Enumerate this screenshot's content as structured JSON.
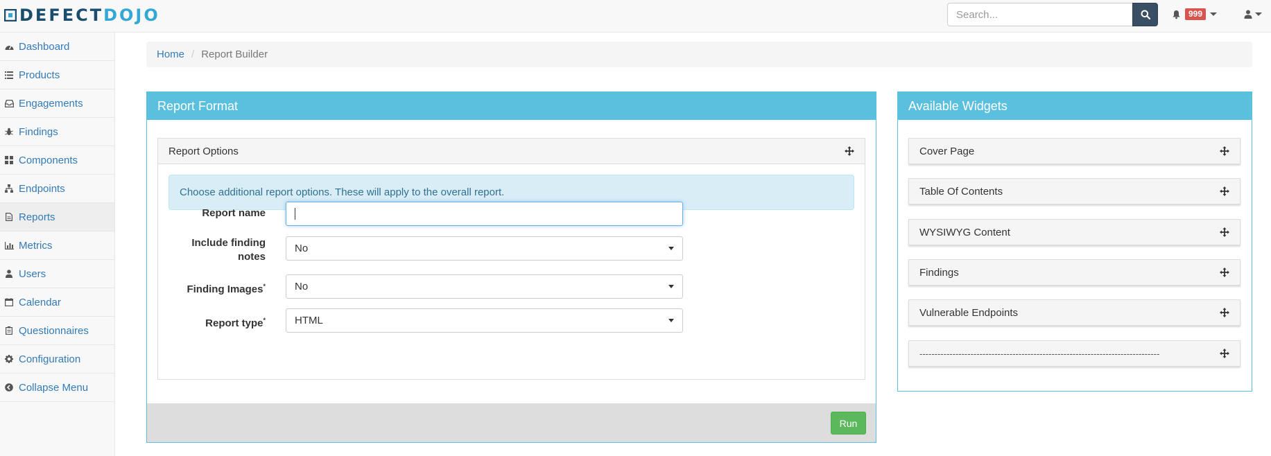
{
  "app": {
    "logo_part1": "DEFECT",
    "logo_part2": "DOJO"
  },
  "search": {
    "placeholder": "Search..."
  },
  "notifications": {
    "count": "999"
  },
  "sidebar": {
    "items": [
      {
        "label": "Dashboard",
        "icon": "dashboard-icon"
      },
      {
        "label": "Products",
        "icon": "list-icon"
      },
      {
        "label": "Engagements",
        "icon": "inbox-icon"
      },
      {
        "label": "Findings",
        "icon": "bug-icon"
      },
      {
        "label": "Components",
        "icon": "grid-icon"
      },
      {
        "label": "Endpoints",
        "icon": "sitemap-icon"
      },
      {
        "label": "Reports",
        "icon": "file-icon"
      },
      {
        "label": "Metrics",
        "icon": "bar-chart-icon"
      },
      {
        "label": "Users",
        "icon": "user-icon"
      },
      {
        "label": "Calendar",
        "icon": "calendar-icon"
      },
      {
        "label": "Questionnaires",
        "icon": "clipboard-icon"
      },
      {
        "label": "Configuration",
        "icon": "gear-icon"
      },
      {
        "label": "Collapse Menu",
        "icon": "arrow-circle-left-icon"
      }
    ]
  },
  "breadcrumb": {
    "home": "Home",
    "current": "Report Builder"
  },
  "report_format": {
    "title": "Report Format",
    "options_title": "Report Options",
    "alert": "Choose additional report options. These will apply to the overall report.",
    "fields": {
      "report_name": {
        "label": "Report name",
        "value": ""
      },
      "include_notes": {
        "label_line1": "Include finding",
        "label_line2": "notes",
        "value": "No"
      },
      "finding_images": {
        "label": "Finding Images",
        "required": "*",
        "value": "No"
      },
      "report_type": {
        "label": "Report type",
        "required": "*",
        "value": "HTML"
      }
    },
    "run_label": "Run"
  },
  "available_widgets": {
    "title": "Available Widgets",
    "items": [
      "Cover Page",
      "Table Of Contents",
      "WYSIWYG Content",
      "Findings",
      "Vulnerable Endpoints",
      "--------------------------------------------------------------------------------"
    ]
  }
}
